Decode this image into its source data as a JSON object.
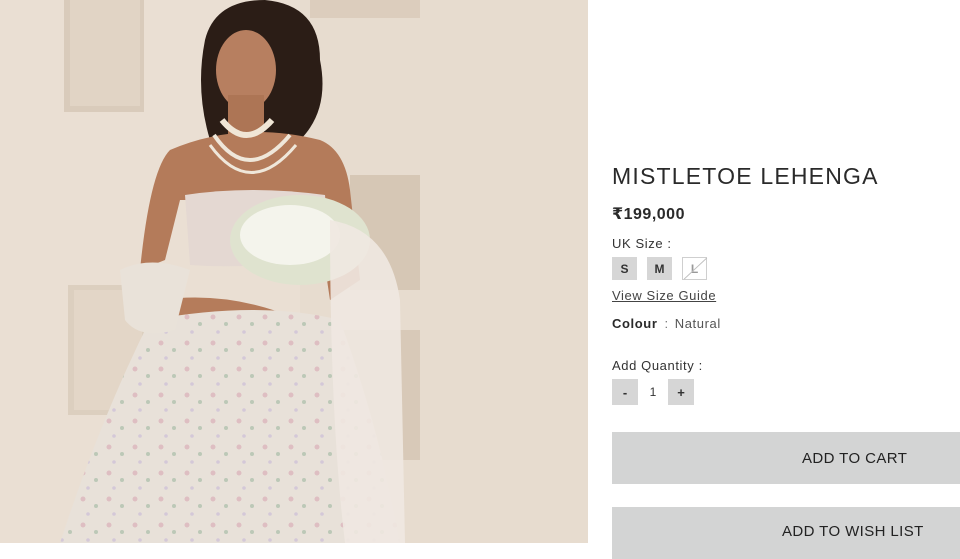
{
  "product": {
    "title": "MISTLETOE LEHENGA",
    "price": "₹199,000"
  },
  "size": {
    "label": "UK Size :",
    "options": [
      {
        "label": "S",
        "available": true
      },
      {
        "label": "M",
        "available": true
      },
      {
        "label": "L",
        "available": false
      }
    ],
    "guide_link": "View Size Guide"
  },
  "colour": {
    "label": "Colour",
    "separator": ":",
    "value": "Natural"
  },
  "quantity": {
    "label": "Add Quantity :",
    "minus": "-",
    "value": "1",
    "plus": "+"
  },
  "actions": {
    "add_to_cart": "ADD TO CART",
    "add_to_wishlist": "ADD TO WISH LIST"
  },
  "colors": {
    "button_gray": "#d6d6d6",
    "cta_gray": "#d3d4d4",
    "wall": "#e9ddd0"
  }
}
